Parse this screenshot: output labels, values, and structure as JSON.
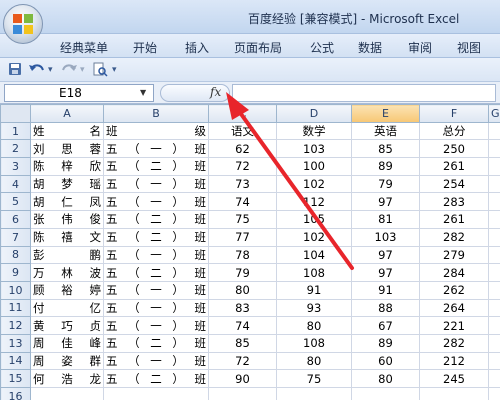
{
  "window": {
    "title": "百度经验  [兼容模式] - Microsoft Excel"
  },
  "menu": {
    "tabs": [
      "经典菜单",
      "开始",
      "插入",
      "页面布局",
      "公式",
      "数据",
      "审阅",
      "视图"
    ]
  },
  "formula_bar": {
    "name_box": "E18",
    "fx": "fx",
    "formula": ""
  },
  "columns": [
    "",
    "A",
    "B",
    "C",
    "D",
    "E",
    "F",
    "G"
  ],
  "header_row": {
    "row": "1",
    "name": "姓    名",
    "class": "班    级",
    "chinese": "语文",
    "math": "数学",
    "english": "英语",
    "total": "总分"
  },
  "rows": [
    {
      "row": "2",
      "name": "刘 思 蓉",
      "class": "五（一）班",
      "chinese": "62",
      "math": "103",
      "english": "85",
      "total": "250"
    },
    {
      "row": "3",
      "name": "陈 梓 欣",
      "class": "五（二）班",
      "chinese": "72",
      "math": "100",
      "english": "89",
      "total": "261"
    },
    {
      "row": "4",
      "name": "胡 梦 瑶",
      "class": "五（一）班",
      "chinese": "73",
      "math": "102",
      "english": "79",
      "total": "254"
    },
    {
      "row": "5",
      "name": "胡 仁 凤",
      "class": "五（一）班",
      "chinese": "74",
      "math": "112",
      "english": "97",
      "total": "283"
    },
    {
      "row": "6",
      "name": "张 伟 俊",
      "class": "五（二）班",
      "chinese": "75",
      "math": "105",
      "english": "81",
      "total": "261"
    },
    {
      "row": "7",
      "name": "陈 禧 文",
      "class": "五（二）班",
      "chinese": "77",
      "math": "102",
      "english": "103",
      "total": "282"
    },
    {
      "row": "8",
      "name": "彭     鹏",
      "class": "五（一）班",
      "chinese": "78",
      "math": "104",
      "english": "97",
      "total": "279"
    },
    {
      "row": "9",
      "name": "万 林 波",
      "class": "五（二）班",
      "chinese": "79",
      "math": "108",
      "english": "97",
      "total": "284"
    },
    {
      "row": "10",
      "name": "顾 裕 婷",
      "class": "五（一）班",
      "chinese": "80",
      "math": "91",
      "english": "91",
      "total": "262"
    },
    {
      "row": "11",
      "name": "付     亿",
      "class": "五（一）班",
      "chinese": "83",
      "math": "93",
      "english": "88",
      "total": "264"
    },
    {
      "row": "12",
      "name": "黄 巧 贞",
      "class": "五（一）班",
      "chinese": "74",
      "math": "80",
      "english": "67",
      "total": "221"
    },
    {
      "row": "13",
      "name": "周 佳 峰",
      "class": "五（二）班",
      "chinese": "85",
      "math": "108",
      "english": "89",
      "total": "282"
    },
    {
      "row": "14",
      "name": "周 姿 群",
      "class": "五（一）班",
      "chinese": "72",
      "math": "80",
      "english": "60",
      "total": "212"
    },
    {
      "row": "15",
      "name": "何 浩 龙",
      "class": "五（二）班",
      "chinese": "90",
      "math": "75",
      "english": "80",
      "total": "245"
    },
    {
      "row": "16",
      "name": "",
      "class": "",
      "chinese": "",
      "math": "",
      "english": "",
      "total": ""
    }
  ],
  "colors": {
    "annotation_arrow": "#e8252b",
    "selected_column_header": "#f7c774"
  },
  "icons": [
    "office-logo-icon",
    "save-icon",
    "undo-icon",
    "redo-icon",
    "print-preview-icon",
    "customize-qat-icon",
    "dropdown-arrow-icon",
    "fx-icon",
    "annotation-arrow-icon"
  ]
}
